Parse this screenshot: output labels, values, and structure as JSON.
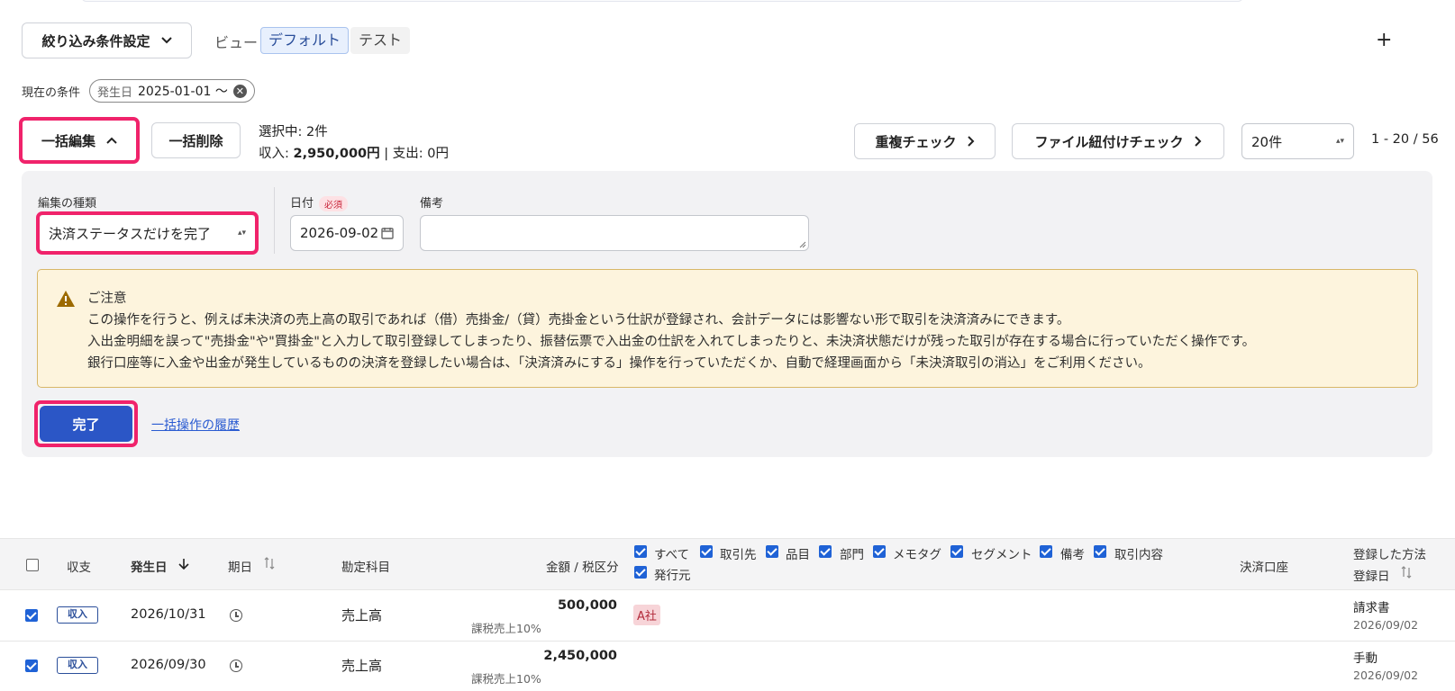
{
  "filter": {
    "settings_label": "絞り込み条件設定",
    "view_label": "ビュー",
    "views": [
      "デフォルト",
      "テスト"
    ],
    "add_label": "+"
  },
  "conditions": {
    "label": "現在の条件",
    "chip_key": "発生日",
    "chip_value": "2025-01-01 〜"
  },
  "toolbar": {
    "bulk_edit_label": "一括編集",
    "bulk_delete_label": "一括削除",
    "selected_text": "選択中: 2件",
    "totals_prefix": "収入: ",
    "totals_income": "2,950,000円",
    "totals_rest": " | 支出: 0円",
    "dup_check_label": "重複チェック",
    "file_check_label": "ファイル紐付けチェック",
    "page_size": "20件",
    "page_range": "1 - 20 / 56"
  },
  "edit_panel": {
    "type_label": "編集の種類",
    "type_value": "決済ステータスだけを完了",
    "date_label": "日付",
    "required_label": "必須",
    "date_value": "2026-09-02",
    "note_label": "備考",
    "note_value": "",
    "notice_title": "ご注意",
    "notice_lines": [
      "この操作を行うと、例えば未決済の売上高の取引であれば（借）売掛金/（貸）売掛金という仕訳が登録され、会計データには影響ない形で取引を決済済みにできます。",
      "入出金明細を誤って\"売掛金\"や\"買掛金\"と入力して取引登録してしまったり、振替伝票で入出金の仕訳を入れてしまったりと、未決済状態だけが残った取引が存在する場合に行っていただく操作です。",
      "銀行口座等に入金や出金が発生しているものの決済を登録したい場合は、「決済済みにする」操作を行っていただくか、自動で経理画面から「未決済取引の消込」をご利用ください。"
    ],
    "done_label": "完了",
    "history_link": "一括操作の履歴"
  },
  "table": {
    "headers": {
      "type": "収支",
      "date": "発生日",
      "due": "期日",
      "account": "勘定科目",
      "amount": "金額 / 税区分",
      "settle_account": "決済口座",
      "method": "登録した方法",
      "registered": "登録日"
    },
    "column_toggles": [
      "すべて",
      "取引先",
      "品目",
      "部門",
      "メモタグ",
      "セグメント",
      "備考",
      "取引内容",
      "発行元"
    ],
    "rows": [
      {
        "type": "収入",
        "date": "2026/10/31",
        "account": "売上高",
        "amount": "500,000",
        "tax": "課税売上10%",
        "partner": "A社",
        "method": "請求書",
        "registered": "2026/09/02"
      },
      {
        "type": "収入",
        "date": "2026/09/30",
        "account": "売上高",
        "amount": "2,450,000",
        "tax": "課税売上10%",
        "partner": "",
        "method": "手動",
        "registered": "2026/09/02"
      }
    ]
  }
}
